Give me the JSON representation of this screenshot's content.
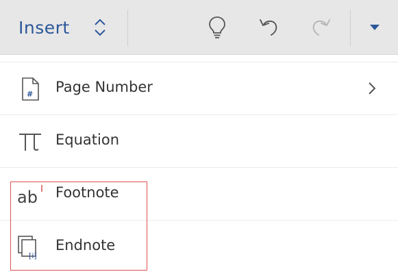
{
  "toolbar": {
    "tab_label": "Insert",
    "icons": {
      "tab_switch": "up-down-chevron-icon",
      "tell_me": "lightbulb-icon",
      "undo": "undo-icon",
      "redo": "redo-icon",
      "more": "caret-down-icon"
    },
    "redo_enabled": false
  },
  "menu": {
    "items": [
      {
        "label": "Page Number",
        "icon": "page-number-icon",
        "has_submenu": true
      },
      {
        "label": "Equation",
        "icon": "pi-icon",
        "has_submenu": false
      },
      {
        "label": "Footnote",
        "icon": "footnote-icon",
        "has_submenu": false
      },
      {
        "label": "Endnote",
        "icon": "endnote-icon",
        "has_submenu": false
      }
    ]
  },
  "colors": {
    "accent": "#2b579a",
    "toolbar_bg": "#e7e7e7",
    "icon_gray": "#555555",
    "disabled": "#b5b5b5",
    "highlight": "#e05050"
  }
}
